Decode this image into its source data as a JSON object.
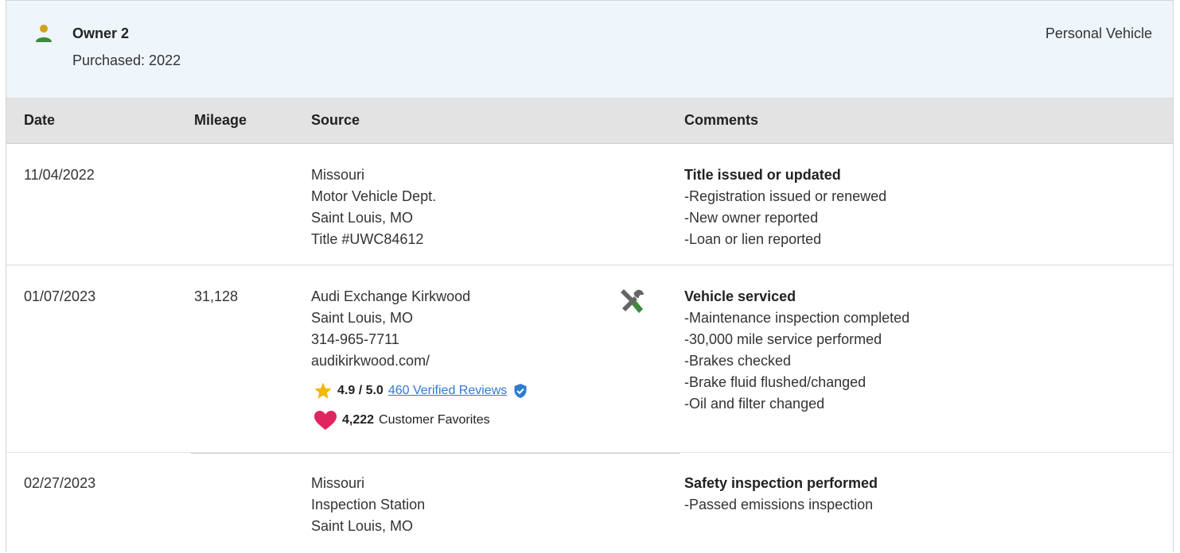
{
  "owner": {
    "title": "Owner 2",
    "purchased": "Purchased: 2022",
    "vehicle_type": "Personal Vehicle",
    "icon": "person-icon",
    "icon_color": "#3d8b3d"
  },
  "table": {
    "headers": [
      "Date",
      "Mileage",
      "Source",
      "Comments"
    ],
    "rows": [
      {
        "date": "11/04/2022",
        "mileage": "",
        "source": [
          "Missouri",
          "Motor Vehicle Dept.",
          "Saint Louis, MO",
          "Title #UWC84612"
        ],
        "comment_title": "Title issued or updated",
        "comments": [
          "Registration issued or renewed",
          "New owner reported",
          "Loan or lien reported"
        ]
      },
      {
        "date": "01/07/2023",
        "mileage": "31,128",
        "source": [
          "Audi Exchange Kirkwood",
          "Saint Louis, MO",
          "314-965-7711",
          "audikirkwood.com/"
        ],
        "rating": "4.9 / 5.0",
        "reviews_link": "460 Verified Reviews",
        "favorites_count": "4,222",
        "favorites_label": "Customer Favorites",
        "service_icon": "tools-icon",
        "comment_title": "Vehicle serviced",
        "comments": [
          "Maintenance inspection completed",
          "30,000 mile service performed",
          "Brakes checked",
          "Brake fluid flushed/changed",
          "Oil and filter changed"
        ]
      },
      {
        "date": "02/27/2023",
        "mileage": "",
        "source": [
          "Missouri",
          "Inspection Station",
          "Saint Louis, MO"
        ],
        "comment_title": "Safety inspection performed",
        "comments": [
          "Passed emissions inspection"
        ]
      }
    ]
  },
  "colors": {
    "header_bg": "#eef5fb",
    "table_head_bg": "#e3e3e3",
    "link": "#2f7bd1",
    "star": "#f5b800",
    "heart": "#e0245e",
    "verified": "#2f7bd1"
  }
}
